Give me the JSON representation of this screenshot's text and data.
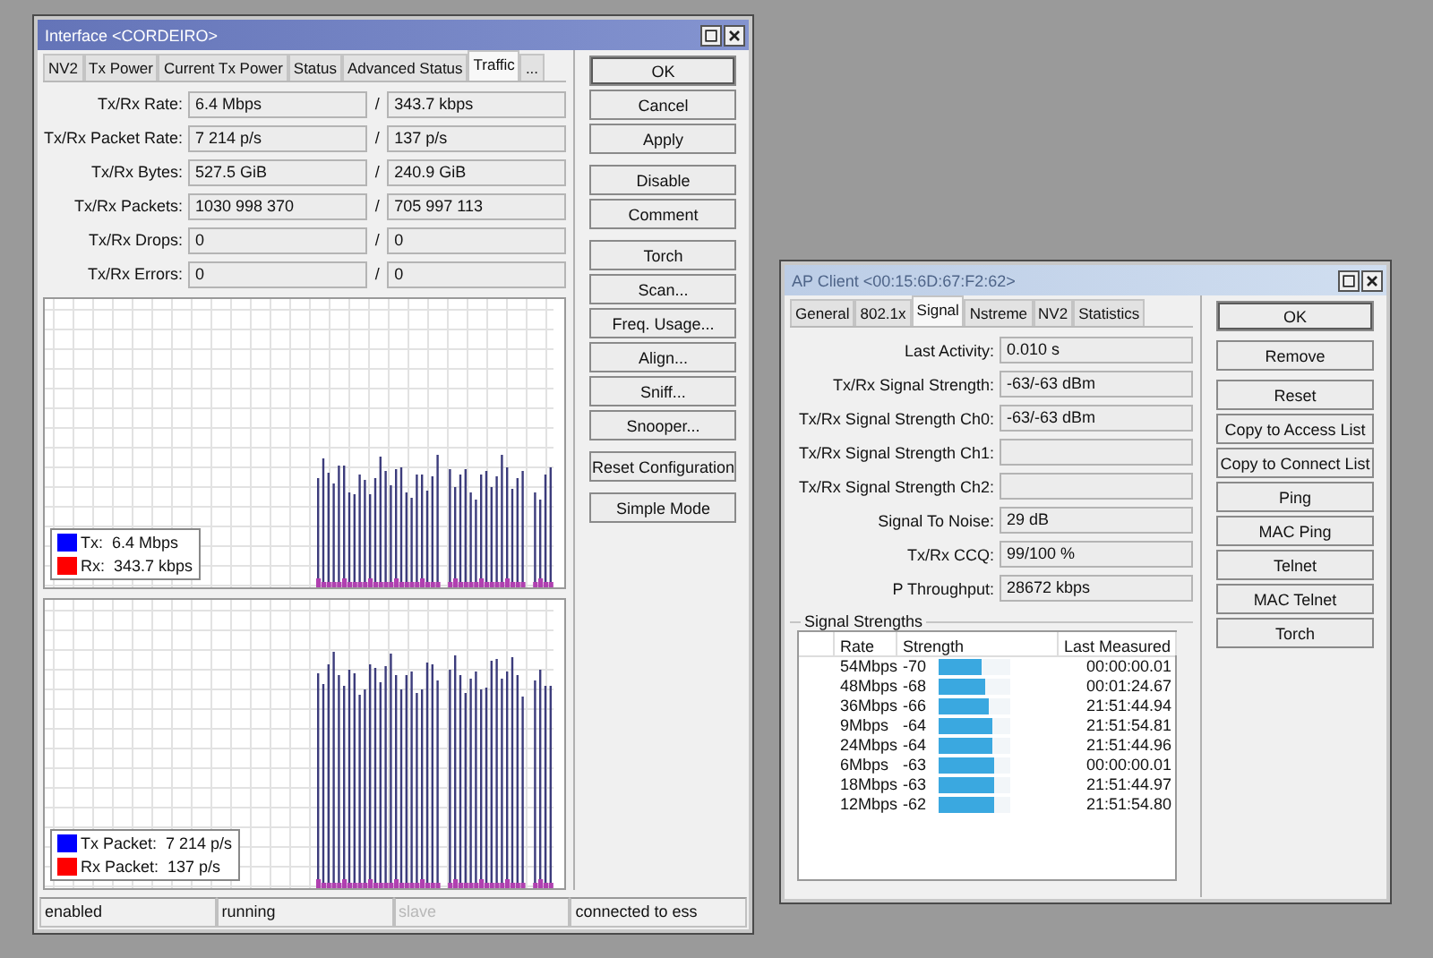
{
  "interface_window": {
    "title": "Interface <CORDEIRO>",
    "active": true,
    "tabs": [
      {
        "label": "NV2",
        "selected": false
      },
      {
        "label": "Tx Power",
        "selected": false
      },
      {
        "label": "Current Tx Power",
        "selected": false
      },
      {
        "label": "Status",
        "selected": false
      },
      {
        "label": "Advanced Status",
        "selected": false
      },
      {
        "label": "Traffic",
        "selected": true
      },
      {
        "label": "...",
        "selected": false
      }
    ],
    "fields": [
      {
        "label": "Tx/Rx Rate:",
        "tx": "6.4 Mbps",
        "rx": "343.7 kbps"
      },
      {
        "label": "Tx/Rx Packet Rate:",
        "tx": "7 214 p/s",
        "rx": "137 p/s"
      },
      {
        "label": "Tx/Rx Bytes:",
        "tx": "527.5 GiB",
        "rx": "240.9 GiB"
      },
      {
        "label": "Tx/Rx Packets:",
        "tx": "1030 998 370",
        "rx": "705 997 113"
      },
      {
        "label": "Tx/Rx Drops:",
        "tx": "0",
        "rx": "0"
      },
      {
        "label": "Tx/Rx Errors:",
        "tx": "0",
        "rx": "0"
      }
    ],
    "separator": "/",
    "graphs": [
      {
        "legend": [
          {
            "text": "Tx:  6.4 Mbps",
            "color": "#0000ff"
          },
          {
            "text": "Rx:  343.7 kbps",
            "color": "#ff0000"
          }
        ]
      },
      {
        "legend": [
          {
            "text": "Tx Packet:  7 214 p/s",
            "color": "#0000ff"
          },
          {
            "text": "Rx Packet:  137 p/s",
            "color": "#ff0000"
          }
        ]
      }
    ],
    "buttons": [
      [
        {
          "label": "OK",
          "default": true
        },
        {
          "label": "Cancel",
          "default": false
        },
        {
          "label": "Apply",
          "default": false
        }
      ],
      [
        {
          "label": "Disable",
          "default": false
        },
        {
          "label": "Comment",
          "default": false
        }
      ],
      [
        {
          "label": "Torch",
          "default": false
        },
        {
          "label": "Scan...",
          "default": false
        },
        {
          "label": "Freq. Usage...",
          "default": false
        },
        {
          "label": "Align...",
          "default": false
        },
        {
          "label": "Sniff...",
          "default": false
        },
        {
          "label": "Snooper...",
          "default": false
        }
      ],
      [
        {
          "label": "Reset Configuration",
          "default": false
        }
      ],
      [
        {
          "label": "Simple Mode",
          "default": false
        }
      ]
    ],
    "status_bar": [
      {
        "text": "enabled",
        "disabled": false
      },
      {
        "text": "running",
        "disabled": false
      },
      {
        "text": "slave",
        "disabled": true
      },
      {
        "text": "connected to ess",
        "disabled": false
      }
    ]
  },
  "ap_client_window": {
    "title": "AP Client <00:15:6D:67:F2:62>",
    "active": false,
    "tabs": [
      {
        "label": "General",
        "selected": false
      },
      {
        "label": "802.1x",
        "selected": false
      },
      {
        "label": "Signal",
        "selected": true
      },
      {
        "label": "Nstreme",
        "selected": false
      },
      {
        "label": "NV2",
        "selected": false
      },
      {
        "label": "Statistics",
        "selected": false
      }
    ],
    "fields": [
      {
        "label": "Last Activity:",
        "value": "0.010 s"
      },
      {
        "label": "Tx/Rx Signal Strength:",
        "value": "-63/-63 dBm"
      },
      {
        "label": "Tx/Rx Signal Strength Ch0:",
        "value": "-63/-63 dBm"
      },
      {
        "label": "Tx/Rx Signal Strength Ch1:"
      },
      {
        "label": "Tx/Rx Signal Strength Ch2:"
      },
      {
        "label": "Signal To Noise:",
        "value": "29 dB"
      },
      {
        "label": "Tx/Rx CCQ:",
        "value": "99/100 %"
      },
      {
        "label": "P Throughput:",
        "value": "28672 kbps"
      }
    ],
    "signal_strengths": {
      "title": "Signal Strengths",
      "columns": [
        "Rate",
        "Strength",
        "Last Measured"
      ],
      "rows": [
        {
          "rate": "54Mbps",
          "strength": "-70",
          "level": 0.6,
          "last_measured": "00:00:00.01"
        },
        {
          "rate": "48Mbps",
          "strength": "-68",
          "level": 0.65,
          "last_measured": "00:01:24.67"
        },
        {
          "rate": "36Mbps",
          "strength": "-66",
          "level": 0.7,
          "last_measured": "21:51:44.94"
        },
        {
          "rate": "9Mbps",
          "strength": "-64",
          "level": 0.75,
          "last_measured": "21:51:54.81"
        },
        {
          "rate": "24Mbps",
          "strength": "-64",
          "level": 0.75,
          "last_measured": "21:51:44.96"
        },
        {
          "rate": "6Mbps",
          "strength": "-63",
          "level": 0.78,
          "last_measured": "00:00:00.01"
        },
        {
          "rate": "18Mbps",
          "strength": "-63",
          "level": 0.78,
          "last_measured": "21:51:44.97"
        },
        {
          "rate": "12Mbps",
          "strength": "-62",
          "level": 0.78,
          "last_measured": "21:51:54.80"
        }
      ]
    },
    "buttons": [
      [
        {
          "label": "OK",
          "default": true
        }
      ],
      [
        {
          "label": "Remove",
          "default": false
        }
      ],
      [
        {
          "label": "Reset",
          "default": false
        },
        {
          "label": "Copy to Access List",
          "default": false
        },
        {
          "label": "Copy to Connect List",
          "default": false
        },
        {
          "label": "Ping",
          "default": false
        },
        {
          "label": "MAC Ping",
          "default": false
        },
        {
          "label": "Telnet",
          "default": false
        },
        {
          "label": "MAC Telnet",
          "default": false
        },
        {
          "label": "Torch",
          "default": false
        }
      ]
    ]
  }
}
